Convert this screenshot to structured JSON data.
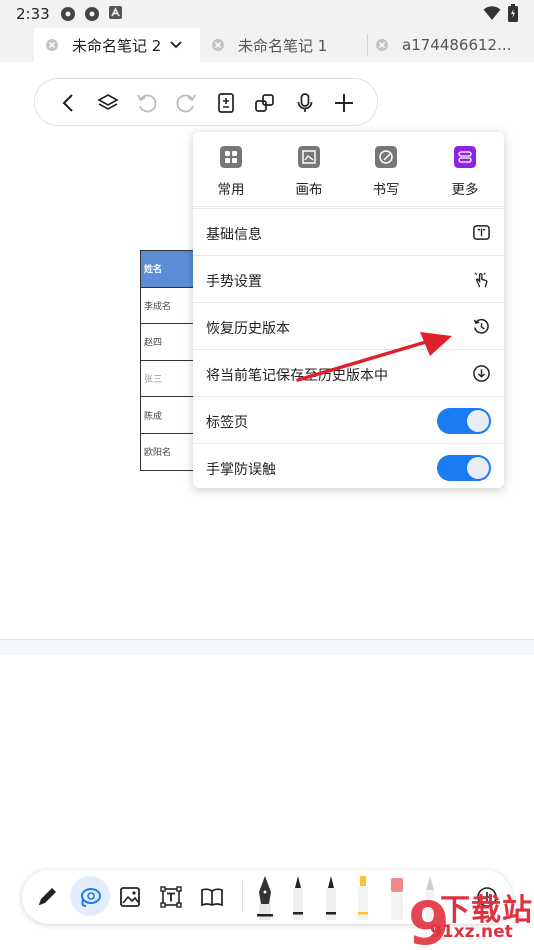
{
  "status_bar": {
    "time": "2:33",
    "notification_icons": [
      "flower-icon",
      "flower-icon",
      "font-a-icon"
    ],
    "system_icons": [
      "wifi-icon",
      "battery-icon"
    ]
  },
  "tabs": [
    {
      "label": "未命名笔记 2",
      "active": true
    },
    {
      "label": "未命名笔记 1",
      "active": false
    },
    {
      "label": "a174486612...",
      "active": false
    }
  ],
  "top_toolbar": {
    "icons": [
      "back-icon",
      "layers-icon",
      "undo-icon",
      "redo-icon",
      "page-icon",
      "duplicate-icon",
      "microphone-icon",
      "add-icon"
    ]
  },
  "doc_table": {
    "rows": [
      "姓名",
      "李成名",
      "赵四",
      "张三",
      "陈成",
      "欧阳名"
    ]
  },
  "menu": {
    "categories": [
      {
        "label": "常用",
        "icon": "grid-icon",
        "color": "#777777"
      },
      {
        "label": "画布",
        "icon": "canvas-icon",
        "color": "#777777"
      },
      {
        "label": "书写",
        "icon": "pen-icon",
        "color": "#777777"
      },
      {
        "label": "更多",
        "icon": "more-icon",
        "color": "#8e24e0"
      }
    ],
    "items": [
      {
        "label": "基础信息",
        "icon": "book-icon"
      },
      {
        "label": "手势设置",
        "icon": "gesture-icon"
      },
      {
        "label": "恢复历史版本",
        "icon": "history-icon"
      },
      {
        "label": "将当前笔记保存至历史版本中",
        "icon": "download-circle-icon"
      },
      {
        "label": "标签页",
        "toggle": true,
        "on": true
      },
      {
        "label": "手掌防误触",
        "toggle": true,
        "on": true
      }
    ]
  },
  "bottom_toolbar": {
    "tools": [
      "pen-tool-icon",
      "lasso-icon",
      "image-icon",
      "text-box-icon",
      "book-icon"
    ],
    "pens": [
      "fountain-pen-icon",
      "marker-black-icon",
      "marker-white-icon",
      "highlighter-yellow-icon",
      "eraser-red-icon",
      "pencil-icon",
      "add-pen-icon"
    ]
  },
  "watermark": {
    "text": "下载站",
    "url": "91xz.net"
  },
  "colors": {
    "accent": "#1a7cf0",
    "table_header": "#5b8ed6",
    "annotation_arrow": "#e0202a"
  }
}
